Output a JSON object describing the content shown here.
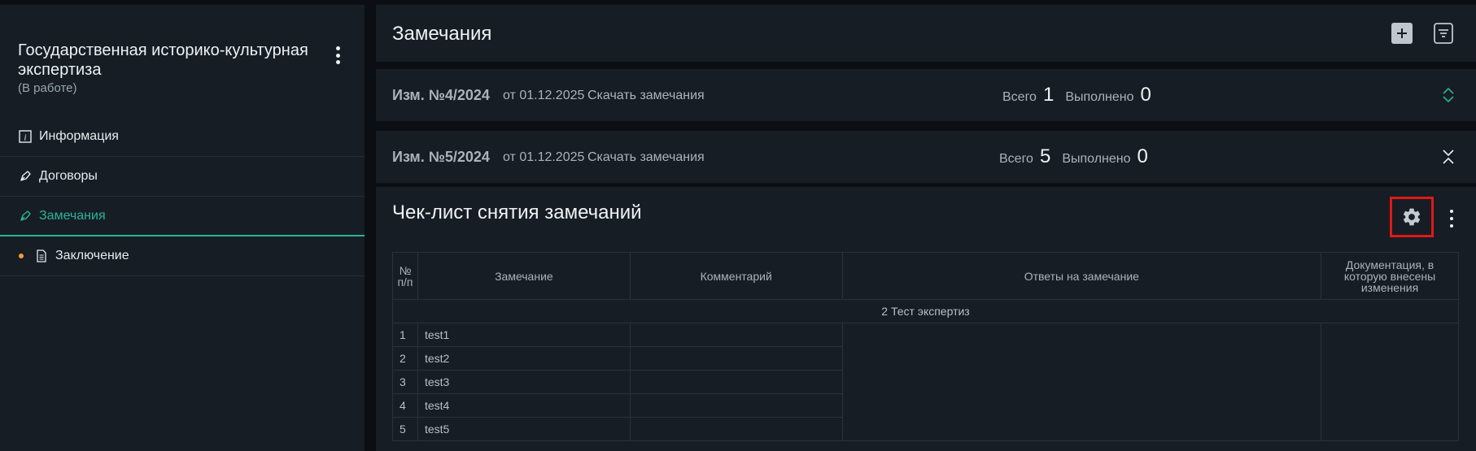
{
  "sidebar": {
    "title": "Государственная историко-культурная экспертиза",
    "status": "(В работе)",
    "items": [
      {
        "label": "Информация",
        "icon": "info-icon"
      },
      {
        "label": "Договоры",
        "icon": "pen-icon"
      },
      {
        "label": "Замечания",
        "icon": "pen-icon",
        "active": true
      },
      {
        "label": "Заключение",
        "icon": "document-icon"
      }
    ]
  },
  "header": {
    "title": "Замечания"
  },
  "revisions": [
    {
      "label": "Изм. №4/2024",
      "date": "от 01.12.2025",
      "link": "Скачать замечания",
      "total_label": "Всего",
      "total": "1",
      "done_label": "Выполнено",
      "done": "0"
    },
    {
      "label": "Изм. №5/2024",
      "date": "от 01.12.2025",
      "link": "Скачать замечания",
      "total_label": "Всего",
      "total": "5",
      "done_label": "Выполнено",
      "done": "0"
    }
  ],
  "checklist": {
    "title": "Чек-лист снятия замечаний",
    "columns": [
      "№ п/п",
      "Замечание",
      "Комментарий",
      "Ответы на замечание",
      "Документация, в которую внесены изменения"
    ],
    "group": "2 Тест экспертиз",
    "rows": [
      {
        "n": "1",
        "remark": "test1"
      },
      {
        "n": "2",
        "remark": "test2"
      },
      {
        "n": "3",
        "remark": "test3"
      },
      {
        "n": "4",
        "remark": "test4"
      },
      {
        "n": "5",
        "remark": "test5"
      }
    ]
  },
  "colors": {
    "accent": "#2bb39a",
    "highlight": "#e01818",
    "dot": "#f0a030"
  }
}
